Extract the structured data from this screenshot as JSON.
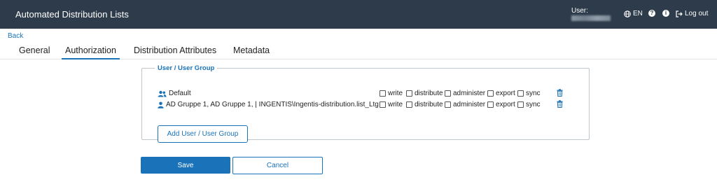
{
  "header": {
    "title": "Automated Distribution Lists",
    "user_label": "User:",
    "language": "EN",
    "help_icon": "question-circle-icon",
    "info_icon": "info-circle-icon",
    "logout_label": "Log out"
  },
  "nav": {
    "back_label": "Back",
    "tabs": [
      {
        "label": "General"
      },
      {
        "label": "Authorization",
        "active": true
      },
      {
        "label": "Distribution Attributes"
      },
      {
        "label": "Metadata"
      }
    ]
  },
  "authorization": {
    "legend": "User / User Group",
    "permissions": [
      "write",
      "distribute",
      "administer",
      "export",
      "sync"
    ],
    "rows": [
      {
        "icon": "user-group-icon",
        "name": "Default"
      },
      {
        "icon": "user-icon",
        "name": "AD Gruppe 1, AD Gruppe 1, | INGENTIS\\Ingentis-distribution.list_Ltg"
      }
    ],
    "add_button_label": "Add User / User Group"
  },
  "actions": {
    "save_label": "Save",
    "cancel_label": "Cancel"
  },
  "colors": {
    "header_bg": "#2d3b4a",
    "accent": "#1a73b8"
  }
}
